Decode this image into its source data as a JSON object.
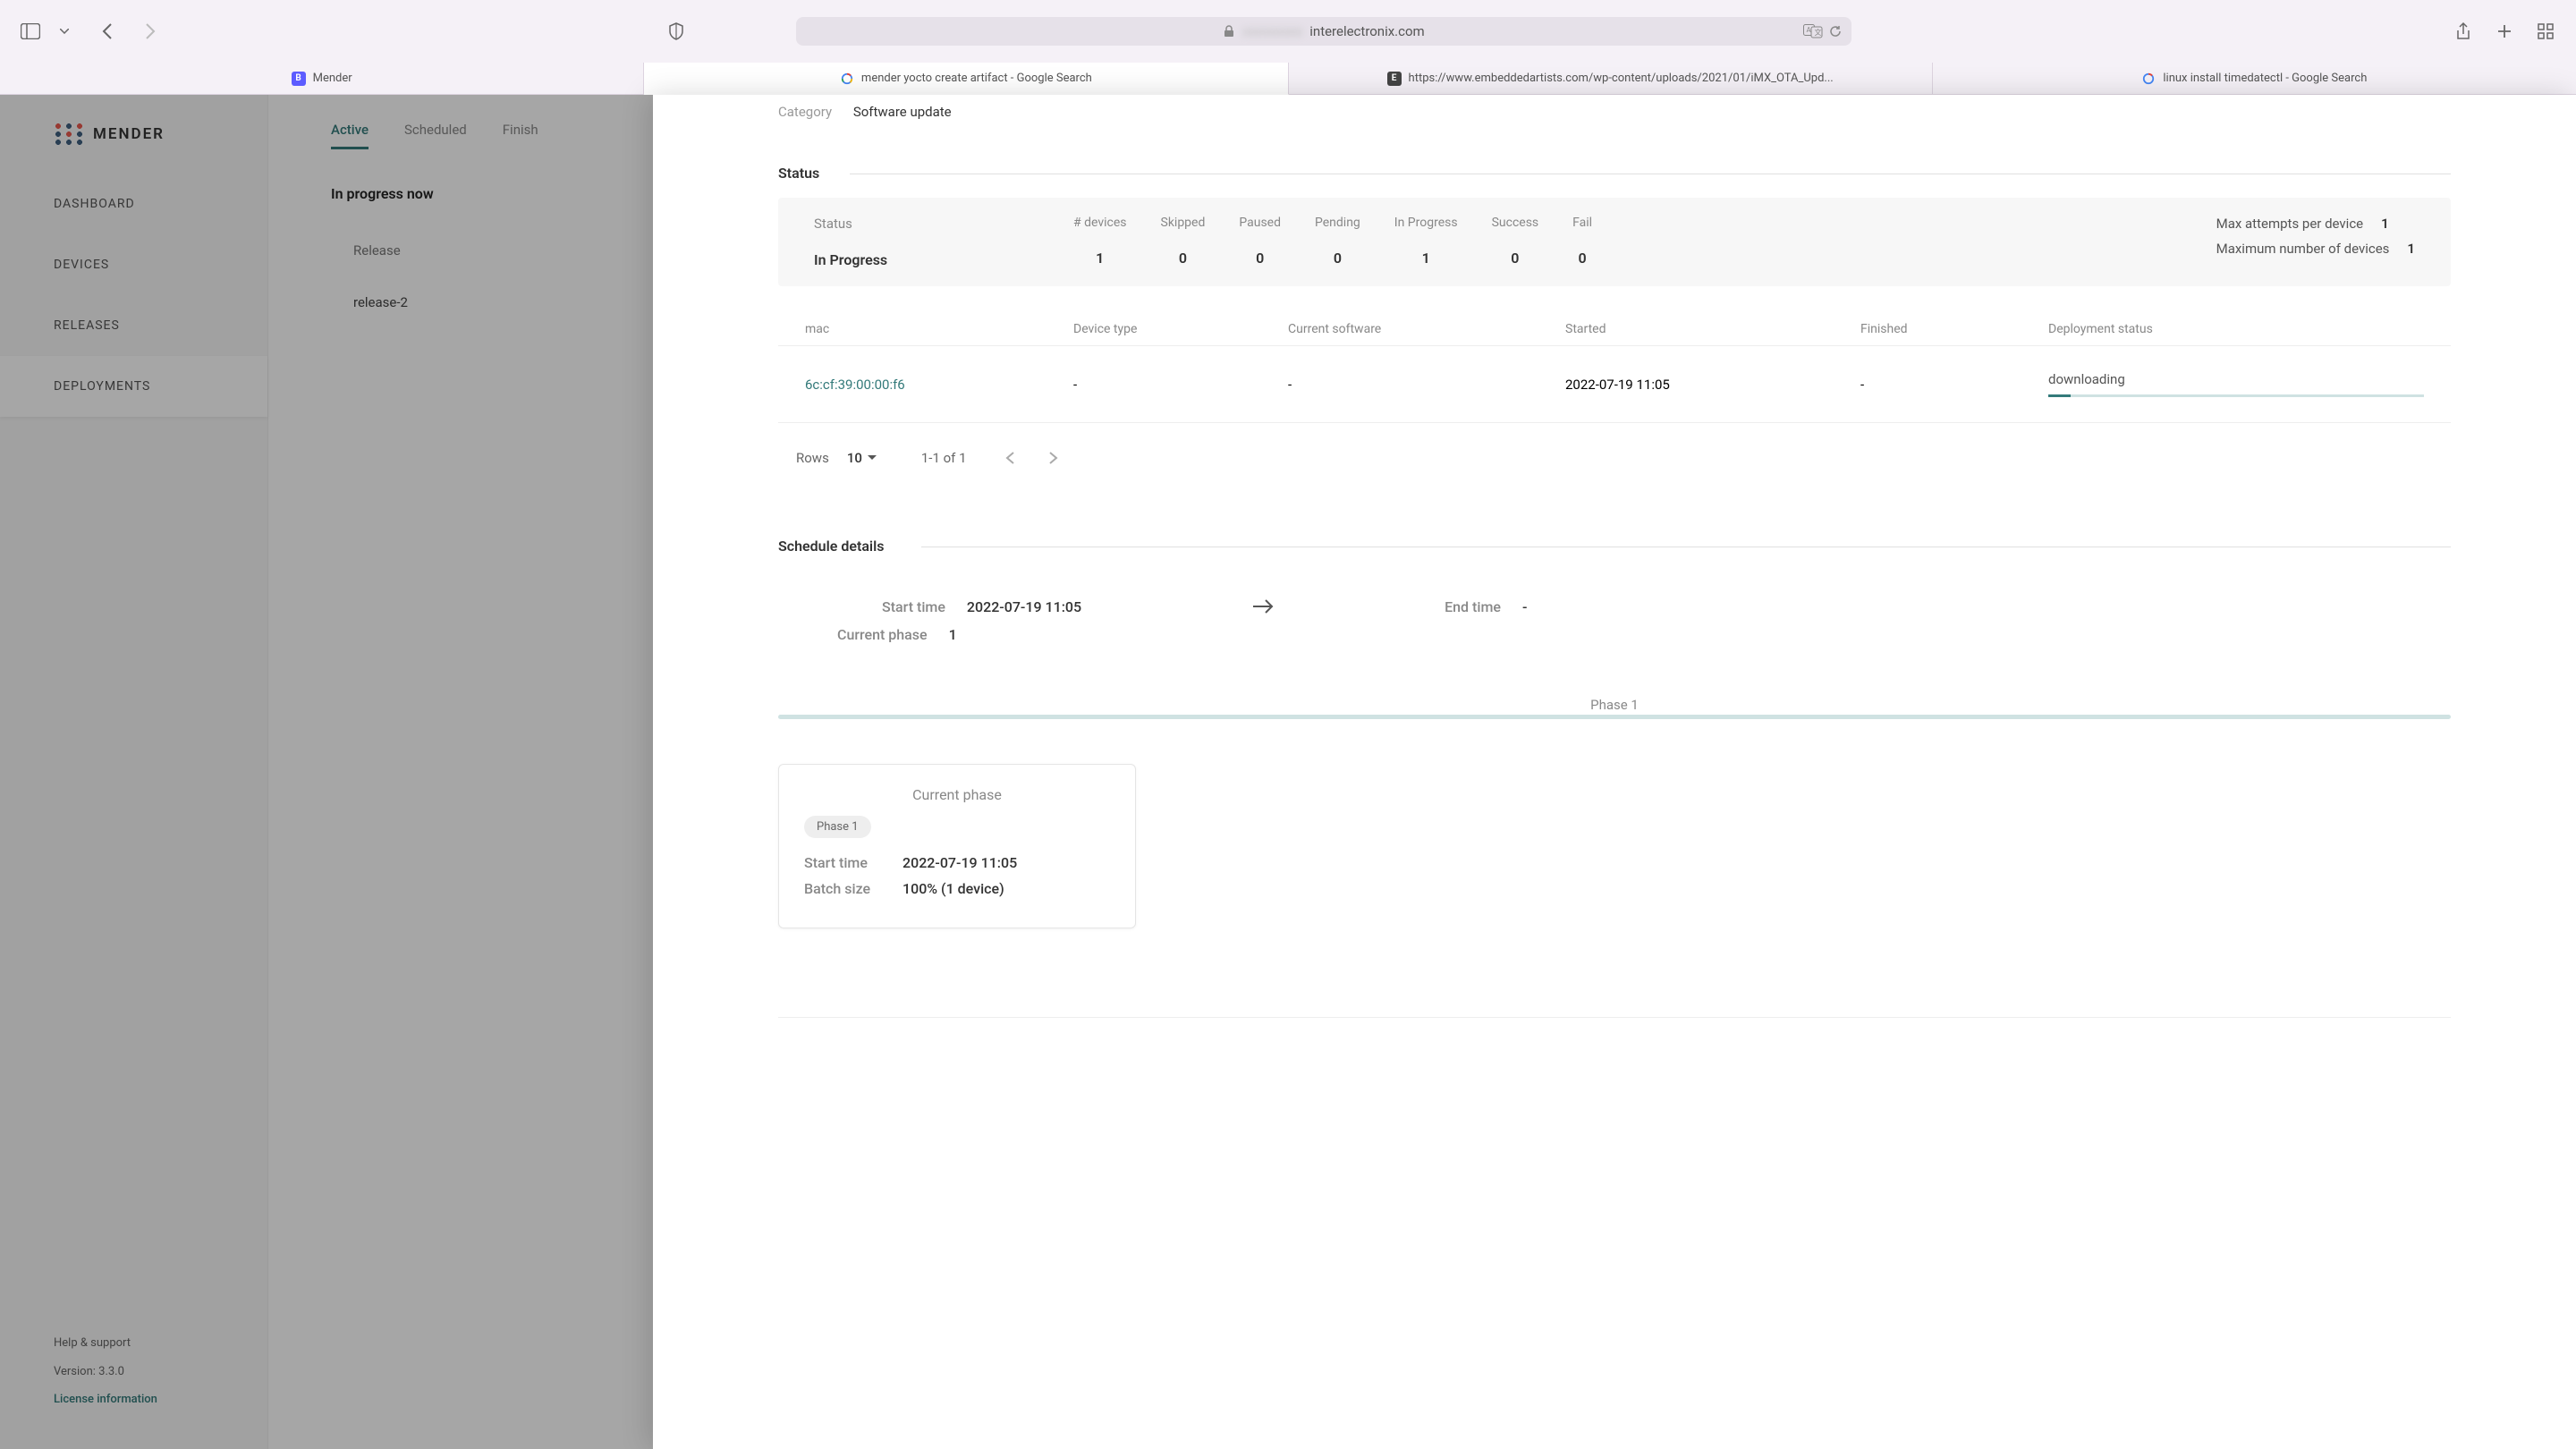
{
  "browser": {
    "address": "interelectronix.com",
    "tabs": [
      {
        "label": "Mender",
        "kind": "b"
      },
      {
        "label": "mender yocto create artifact - Google Search",
        "kind": "g"
      },
      {
        "label": "https://www.embeddedartists.com/wp-content/uploads/2021/01/iMX_OTA_Upd...",
        "kind": "e"
      },
      {
        "label": "linux install timedatectl - Google Search",
        "kind": "g"
      }
    ]
  },
  "sidebar": {
    "logo_text": "MENDER",
    "items": [
      "DASHBOARD",
      "DEVICES",
      "RELEASES",
      "DEPLOYMENTS"
    ],
    "help": "Help & support",
    "version": "Version: 3.3.0",
    "license": "License information"
  },
  "deploy_tabs": [
    "Active",
    "Scheduled",
    "Finish"
  ],
  "deploy_heading": "In progress now",
  "deploy_release_label": "Release",
  "deploy_release_value": "release-2",
  "category_label": "Category",
  "category_value": "Software update",
  "status_title": "Status",
  "status": {
    "label": "Status",
    "value": "In Progress",
    "cols": [
      {
        "h": "# devices",
        "v": "1"
      },
      {
        "h": "Skipped",
        "v": "0"
      },
      {
        "h": "Paused",
        "v": "0"
      },
      {
        "h": "Pending",
        "v": "0"
      },
      {
        "h": "In Progress",
        "v": "1"
      },
      {
        "h": "Success",
        "v": "0"
      },
      {
        "h": "Fail",
        "v": "0"
      }
    ],
    "max_attempts_label": "Max attempts per device",
    "max_attempts_value": "1",
    "max_devices_label": "Maximum number of devices",
    "max_devices_value": "1"
  },
  "table": {
    "headers": [
      "mac",
      "Device type",
      "Current software",
      "Started",
      "Finished",
      "Deployment status"
    ],
    "row": {
      "mac": "6c:cf:39:00:00:f6",
      "device_type": "-",
      "current_software": "-",
      "started": "2022-07-19 11:05",
      "finished": "-",
      "status": "downloading"
    },
    "pager": {
      "rows_label": "Rows",
      "rows_value": "10",
      "range": "1-1 of 1"
    }
  },
  "schedule_title": "Schedule details",
  "schedule": {
    "start_label": "Start time",
    "start_value": "2022-07-19 11:05",
    "end_label": "End time",
    "end_value": "-",
    "phase_label": "Current phase",
    "phase_value": "1"
  },
  "phase_bar_label": "Phase 1",
  "phase_card": {
    "title": "Current phase",
    "badge": "Phase 1",
    "start_label": "Start time",
    "start_value": "2022-07-19 11:05",
    "batch_label": "Batch size",
    "batch_value": "100% (1 device)"
  }
}
